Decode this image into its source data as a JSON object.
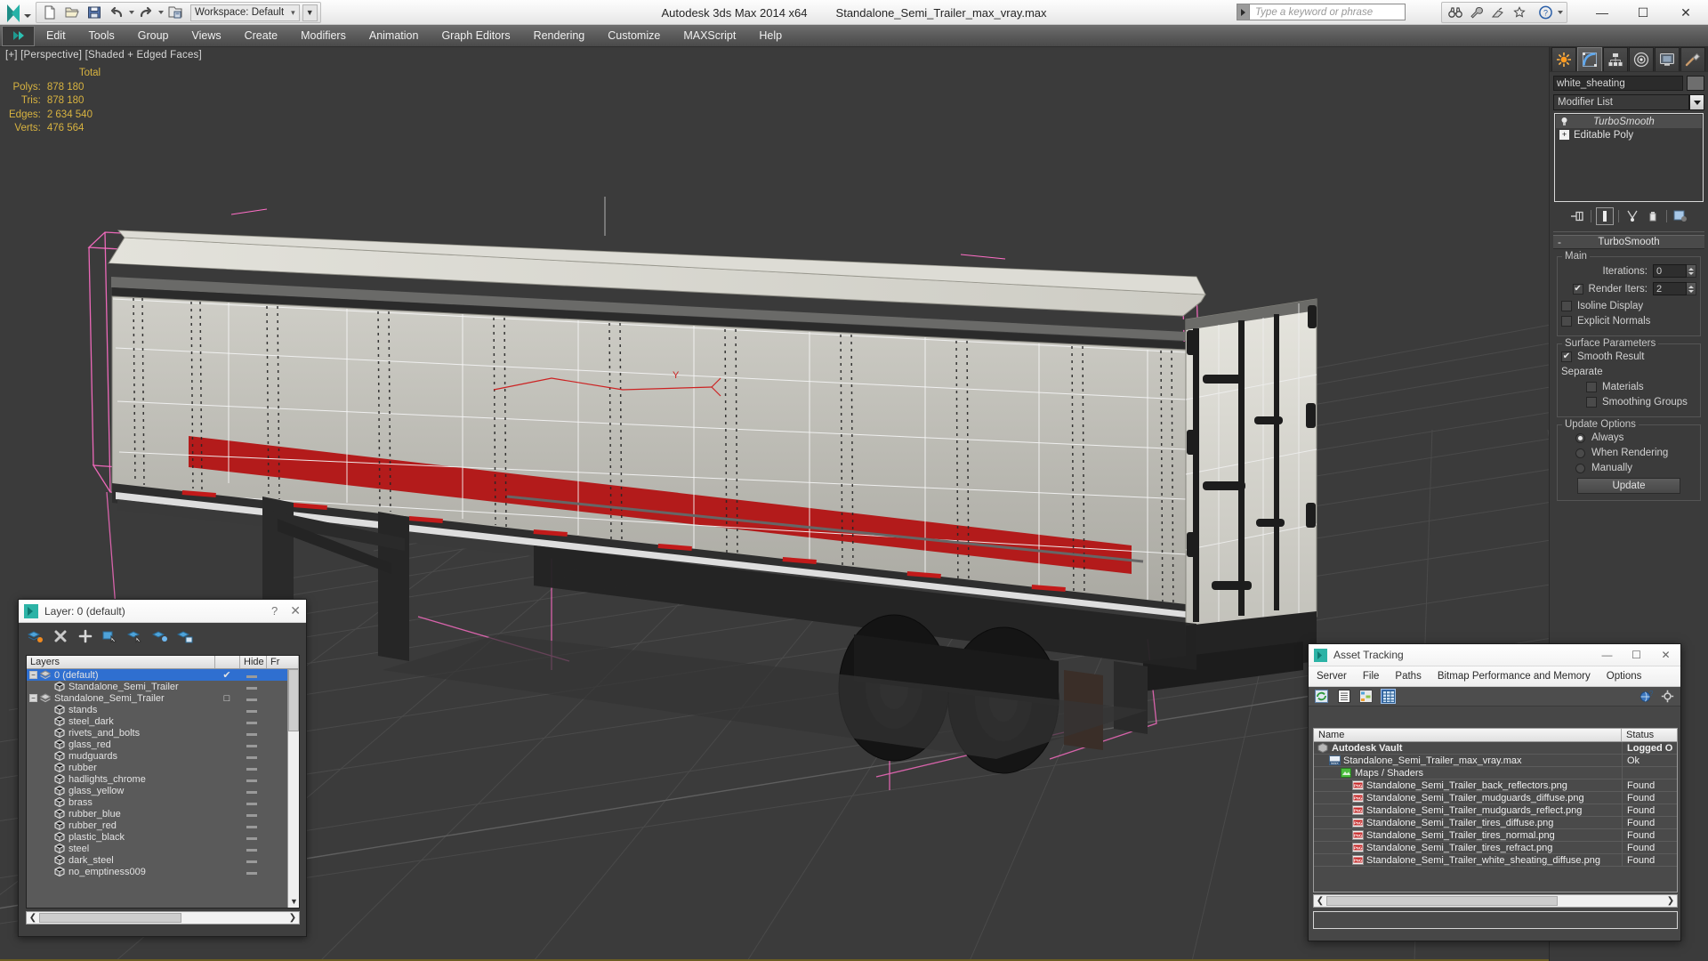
{
  "app": {
    "title": "Autodesk 3ds Max  2014 x64",
    "file": "Standalone_Semi_Trailer_max_vray.max",
    "workspace": "Workspace: Default",
    "search_placeholder": "Type a keyword or phrase"
  },
  "menubar": {
    "items": [
      "Edit",
      "Tools",
      "Group",
      "Views",
      "Create",
      "Modifiers",
      "Animation",
      "Graph Editors",
      "Rendering",
      "Customize",
      "MAXScript",
      "Help"
    ]
  },
  "quick_access": {
    "new_label": "New",
    "open_label": "Open",
    "save_label": "Save",
    "undo_label": "Undo",
    "redo_label": "Redo",
    "setproject_label": "Set Project Folder"
  },
  "window_controls": {
    "minimize": "—",
    "maximize": "☐",
    "close": "✕"
  },
  "viewport": {
    "label": "[+] [Perspective] [Shaded + Edged Faces]",
    "stats": {
      "header": "Total",
      "rows": [
        {
          "key": "Polys:",
          "value": "878 180"
        },
        {
          "key": "Tris:",
          "value": "878 180"
        },
        {
          "key": "Edges:",
          "value": "2 634 540"
        },
        {
          "key": "Verts:",
          "value": "476 564"
        }
      ]
    }
  },
  "command_panel": {
    "tabs": [
      "create-tab",
      "modify-tab",
      "hierarchy-tab",
      "motion-tab",
      "display-tab",
      "utilities-tab"
    ],
    "active_tab_index": 1,
    "object_name": "white_sheating",
    "modifier_list_label": "Modifier List",
    "stack": [
      {
        "label": "TurboSmooth",
        "selected": true
      },
      {
        "label": "Editable Poly",
        "selected": false
      }
    ],
    "rollout": {
      "title": "TurboSmooth",
      "collapse_glyph": "-",
      "groups": [
        {
          "title": "Main",
          "iterations_label": "Iterations:",
          "iterations_value": "0",
          "render_iters_label": "Render Iters:",
          "render_iters_value": "2",
          "render_iters_checked": true,
          "isoline_label": "Isoline Display",
          "isoline_checked": false,
          "explicit_label": "Explicit Normals",
          "explicit_checked": false
        },
        {
          "title": "Surface Parameters",
          "smooth_result_label": "Smooth Result",
          "smooth_result_checked": true,
          "separate_label": "Separate",
          "materials_label": "Materials",
          "materials_checked": false,
          "smoothing_groups_label": "Smoothing Groups",
          "smoothing_groups_checked": false
        },
        {
          "title": "Update Options",
          "always_label": "Always",
          "when_rendering_label": "When Rendering",
          "manually_label": "Manually",
          "selected_option": "Always",
          "update_button": "Update"
        }
      ]
    }
  },
  "layer_dialog": {
    "title": "Layer: 0 (default)",
    "help_glyph": "?",
    "close_glyph": "✕",
    "columns": [
      "Layers",
      "",
      "Hide",
      "Fr"
    ],
    "toolbar": [
      "create-new-layer-icon",
      "delete-layer-icon",
      "add-selection-icon",
      "select-objects-icon",
      "select-highlighted-icon",
      "highlight-selected-icon",
      "layer-properties-icon"
    ],
    "rows": [
      {
        "label": "0 (default)",
        "indent": 0,
        "expander": "−",
        "selected": true,
        "check": "✔",
        "icon": "layer-icon"
      },
      {
        "label": "Standalone_Semi_Trailer",
        "indent": 1,
        "expander": "",
        "selected": false,
        "check": "",
        "icon": "object-icon"
      },
      {
        "label": "Standalone_Semi_Trailer",
        "indent": 0,
        "expander": "−",
        "selected": false,
        "check": "□",
        "icon": "layer-icon"
      },
      {
        "label": "stands",
        "indent": 1,
        "expander": "",
        "selected": false,
        "check": "",
        "icon": "object-icon"
      },
      {
        "label": "steel_dark",
        "indent": 1,
        "expander": "",
        "selected": false,
        "check": "",
        "icon": "object-icon"
      },
      {
        "label": "rivets_and_bolts",
        "indent": 1,
        "expander": "",
        "selected": false,
        "check": "",
        "icon": "object-icon"
      },
      {
        "label": "glass_red",
        "indent": 1,
        "expander": "",
        "selected": false,
        "check": "",
        "icon": "object-icon"
      },
      {
        "label": "mudguards",
        "indent": 1,
        "expander": "",
        "selected": false,
        "check": "",
        "icon": "object-icon"
      },
      {
        "label": "rubber",
        "indent": 1,
        "expander": "",
        "selected": false,
        "check": "",
        "icon": "object-icon"
      },
      {
        "label": "hadlights_chrome",
        "indent": 1,
        "expander": "",
        "selected": false,
        "check": "",
        "icon": "object-icon"
      },
      {
        "label": "glass_yellow",
        "indent": 1,
        "expander": "",
        "selected": false,
        "check": "",
        "icon": "object-icon"
      },
      {
        "label": "brass",
        "indent": 1,
        "expander": "",
        "selected": false,
        "check": "",
        "icon": "object-icon"
      },
      {
        "label": "rubber_blue",
        "indent": 1,
        "expander": "",
        "selected": false,
        "check": "",
        "icon": "object-icon"
      },
      {
        "label": "rubber_red",
        "indent": 1,
        "expander": "",
        "selected": false,
        "check": "",
        "icon": "object-icon"
      },
      {
        "label": "plastic_black",
        "indent": 1,
        "expander": "",
        "selected": false,
        "check": "",
        "icon": "object-icon"
      },
      {
        "label": "steel",
        "indent": 1,
        "expander": "",
        "selected": false,
        "check": "",
        "icon": "object-icon"
      },
      {
        "label": "dark_steel",
        "indent": 1,
        "expander": "",
        "selected": false,
        "check": "",
        "icon": "object-icon"
      },
      {
        "label": "no_emptiness009",
        "indent": 1,
        "expander": "",
        "selected": false,
        "check": "",
        "icon": "object-icon"
      }
    ]
  },
  "asset_tracking": {
    "title": "Asset Tracking",
    "menu": [
      "Server",
      "File",
      "Paths",
      "Bitmap Performance and Memory",
      "Options"
    ],
    "columns": {
      "name": "Name",
      "status": "Status"
    },
    "rows": [
      {
        "name": "Autodesk Vault",
        "status": "Logged O",
        "indent": 0,
        "icon": "vault-icon",
        "bold": true
      },
      {
        "name": "Standalone_Semi_Trailer_max_vray.max",
        "status": "Ok",
        "indent": 1,
        "icon": "max-file-icon",
        "bold": false
      },
      {
        "name": "Maps / Shaders",
        "status": "",
        "indent": 2,
        "icon": "maps-icon",
        "bold": false
      },
      {
        "name": "Standalone_Semi_Trailer_back_reflectors.png",
        "status": "Found",
        "indent": 3,
        "icon": "png-icon",
        "bold": false
      },
      {
        "name": "Standalone_Semi_Trailer_mudguards_diffuse.png",
        "status": "Found",
        "indent": 3,
        "icon": "png-icon",
        "bold": false
      },
      {
        "name": "Standalone_Semi_Trailer_mudguards_reflect.png",
        "status": "Found",
        "indent": 3,
        "icon": "png-icon",
        "bold": false
      },
      {
        "name": "Standalone_Semi_Trailer_tires_diffuse.png",
        "status": "Found",
        "indent": 3,
        "icon": "png-icon",
        "bold": false
      },
      {
        "name": "Standalone_Semi_Trailer_tires_normal.png",
        "status": "Found",
        "indent": 3,
        "icon": "png-icon",
        "bold": false
      },
      {
        "name": "Standalone_Semi_Trailer_tires_refract.png",
        "status": "Found",
        "indent": 3,
        "icon": "png-icon",
        "bold": false
      },
      {
        "name": "Standalone_Semi_Trailer_white_sheating_diffuse.png",
        "status": "Found",
        "indent": 3,
        "icon": "png-icon",
        "bold": false
      }
    ]
  },
  "colors": {
    "accent_yellow": "#d8b340",
    "selection_pink": "#ff6ec7",
    "trailer_stripe_red": "#b31b1b",
    "viewport_bg": "#3b3b3b",
    "highlight_blue": "#2f6fd0"
  },
  "scene": {
    "object_selected": "white_sheating",
    "gizmo_axis": "Y"
  }
}
